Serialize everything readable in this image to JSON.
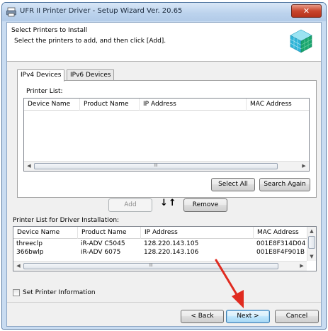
{
  "window": {
    "title": "UFR II Printer Driver - Setup Wizard Ver. 20.65",
    "close_label": "✕"
  },
  "header": {
    "title": "Select Printers to Install",
    "subtitle": "Select the printers to add, and then click [Add]."
  },
  "tabs": [
    {
      "label": "IPv4 Devices",
      "active": true
    },
    {
      "label": "IPv6 Devices",
      "active": false
    }
  ],
  "printer_list": {
    "label": "Printer List:",
    "columns": [
      "Device Name",
      "Product Name",
      "IP Address",
      "MAC Address"
    ],
    "rows": []
  },
  "buttons": {
    "select_all": "Select All",
    "search_again": "Search Again",
    "add": "Add",
    "remove": "Remove",
    "back": "< Back",
    "next": "Next >",
    "cancel": "Cancel"
  },
  "move_arrows": "↓↑",
  "install_list": {
    "label": "Printer List for Driver Installation:",
    "columns": [
      "Device Name",
      "Product Name",
      "IP Address",
      "MAC Address"
    ],
    "rows": [
      {
        "device": "threeclp",
        "product": "iR-ADV C5045",
        "ip": "128.220.143.105",
        "mac": "001E8F314D04"
      },
      {
        "device": "366bwlp",
        "product": "iR-ADV 6075",
        "ip": "128.220.143.106",
        "mac": "001E8F4F901B"
      }
    ]
  },
  "set_printer_info": {
    "label": "Set Printer Information",
    "checked": false
  },
  "scroll_thumb_glyph": "III",
  "colors": {
    "annotation_arrow": "#e02b20",
    "title_bar": "#bcd3ed"
  }
}
